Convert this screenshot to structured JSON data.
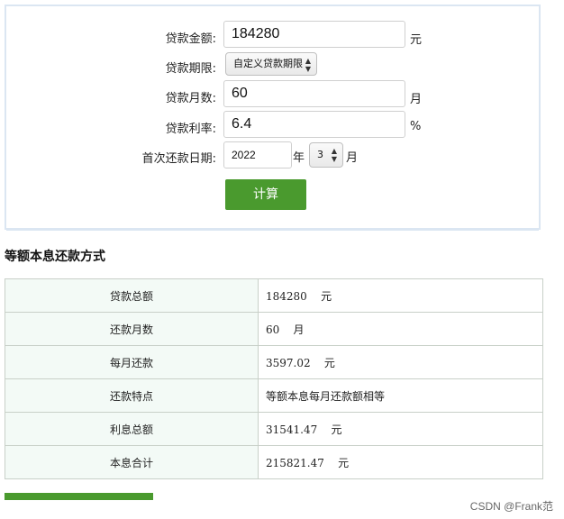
{
  "form": {
    "amount_label": "贷款金额:",
    "amount_value": "184280",
    "amount_unit": "元",
    "term_label": "贷款期限:",
    "term_select": "自定义贷款期限",
    "months_label": "贷款月数:",
    "months_value": "60",
    "months_unit": "月",
    "rate_label": "贷款利率:",
    "rate_value": "6.4",
    "rate_unit": "%",
    "first_date_label": "首次还款日期:",
    "year_value": "2022",
    "year_unit": "年",
    "month_select": "3",
    "month_unit": "月",
    "calc_button": "计算"
  },
  "result": {
    "title": "等额本息还款方式",
    "rows": [
      {
        "key": "贷款总额",
        "value": "184280",
        "unit": "元"
      },
      {
        "key": "还款月数",
        "value": "60",
        "unit": "月"
      },
      {
        "key": "每月还款",
        "value": "3597.02",
        "unit": "元"
      },
      {
        "key": "还款特点",
        "value": "等额本息每月还款额相等",
        "unit": ""
      },
      {
        "key": "利息总额",
        "value": "31541.47",
        "unit": "元"
      },
      {
        "key": "本息合计",
        "value": "215821.47",
        "unit": "元"
      }
    ]
  },
  "watermark": "CSDN @Frank范",
  "colors": {
    "accent": "#4a9a2e",
    "panel_border": "#dbe6f2",
    "key_cell_bg": "#f3faf6"
  }
}
